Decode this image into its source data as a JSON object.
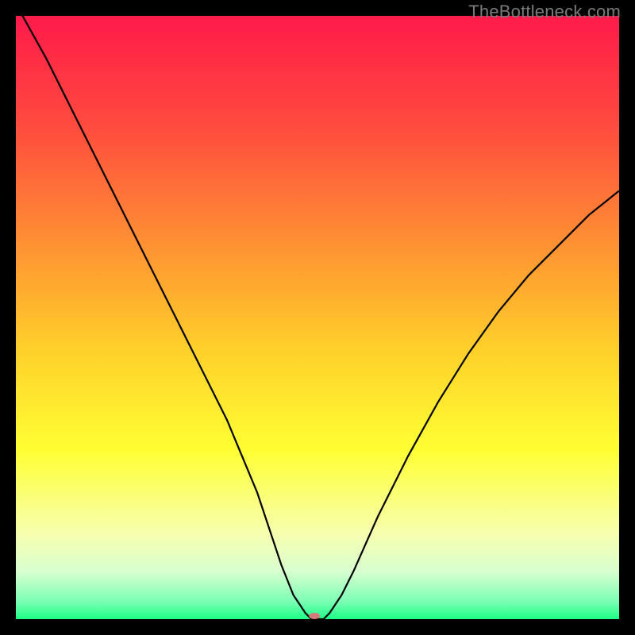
{
  "watermark": "TheBottleneck.com",
  "chart_data": {
    "type": "line",
    "title": "",
    "xlabel": "",
    "ylabel": "",
    "xlim": [
      0,
      100
    ],
    "ylim": [
      0,
      100
    ],
    "grid": false,
    "legend": false,
    "background_gradient": {
      "stops": [
        {
          "offset": 0.0,
          "color": "#ff1a4b"
        },
        {
          "offset": 0.18,
          "color": "#ff4a3e"
        },
        {
          "offset": 0.36,
          "color": "#ff8a34"
        },
        {
          "offset": 0.55,
          "color": "#ffcf2a"
        },
        {
          "offset": 0.72,
          "color": "#ffff33"
        },
        {
          "offset": 0.86,
          "color": "#f6ffb0"
        },
        {
          "offset": 0.92,
          "color": "#d9ffcf"
        },
        {
          "offset": 0.97,
          "color": "#7dffb5"
        },
        {
          "offset": 1.0,
          "color": "#1cff87"
        }
      ]
    },
    "series": [
      {
        "name": "bottleneck-curve",
        "color": "#000000",
        "x": [
          0,
          5,
          10,
          15,
          20,
          25,
          30,
          35,
          40,
          44,
          46,
          48,
          49,
          50,
          51,
          52,
          54,
          56,
          60,
          65,
          70,
          75,
          80,
          85,
          90,
          95,
          100
        ],
        "values": [
          102,
          93,
          83,
          73,
          63,
          53,
          43,
          33,
          21,
          9,
          4,
          1,
          0,
          0,
          0,
          1,
          4,
          8,
          17,
          27,
          36,
          44,
          51,
          57,
          62,
          67,
          71
        ]
      }
    ],
    "marker": {
      "name": "bottleneck-marker",
      "x": 49.5,
      "y": 0,
      "rx": 7,
      "ry": 4,
      "color": "#d47a7a"
    }
  }
}
